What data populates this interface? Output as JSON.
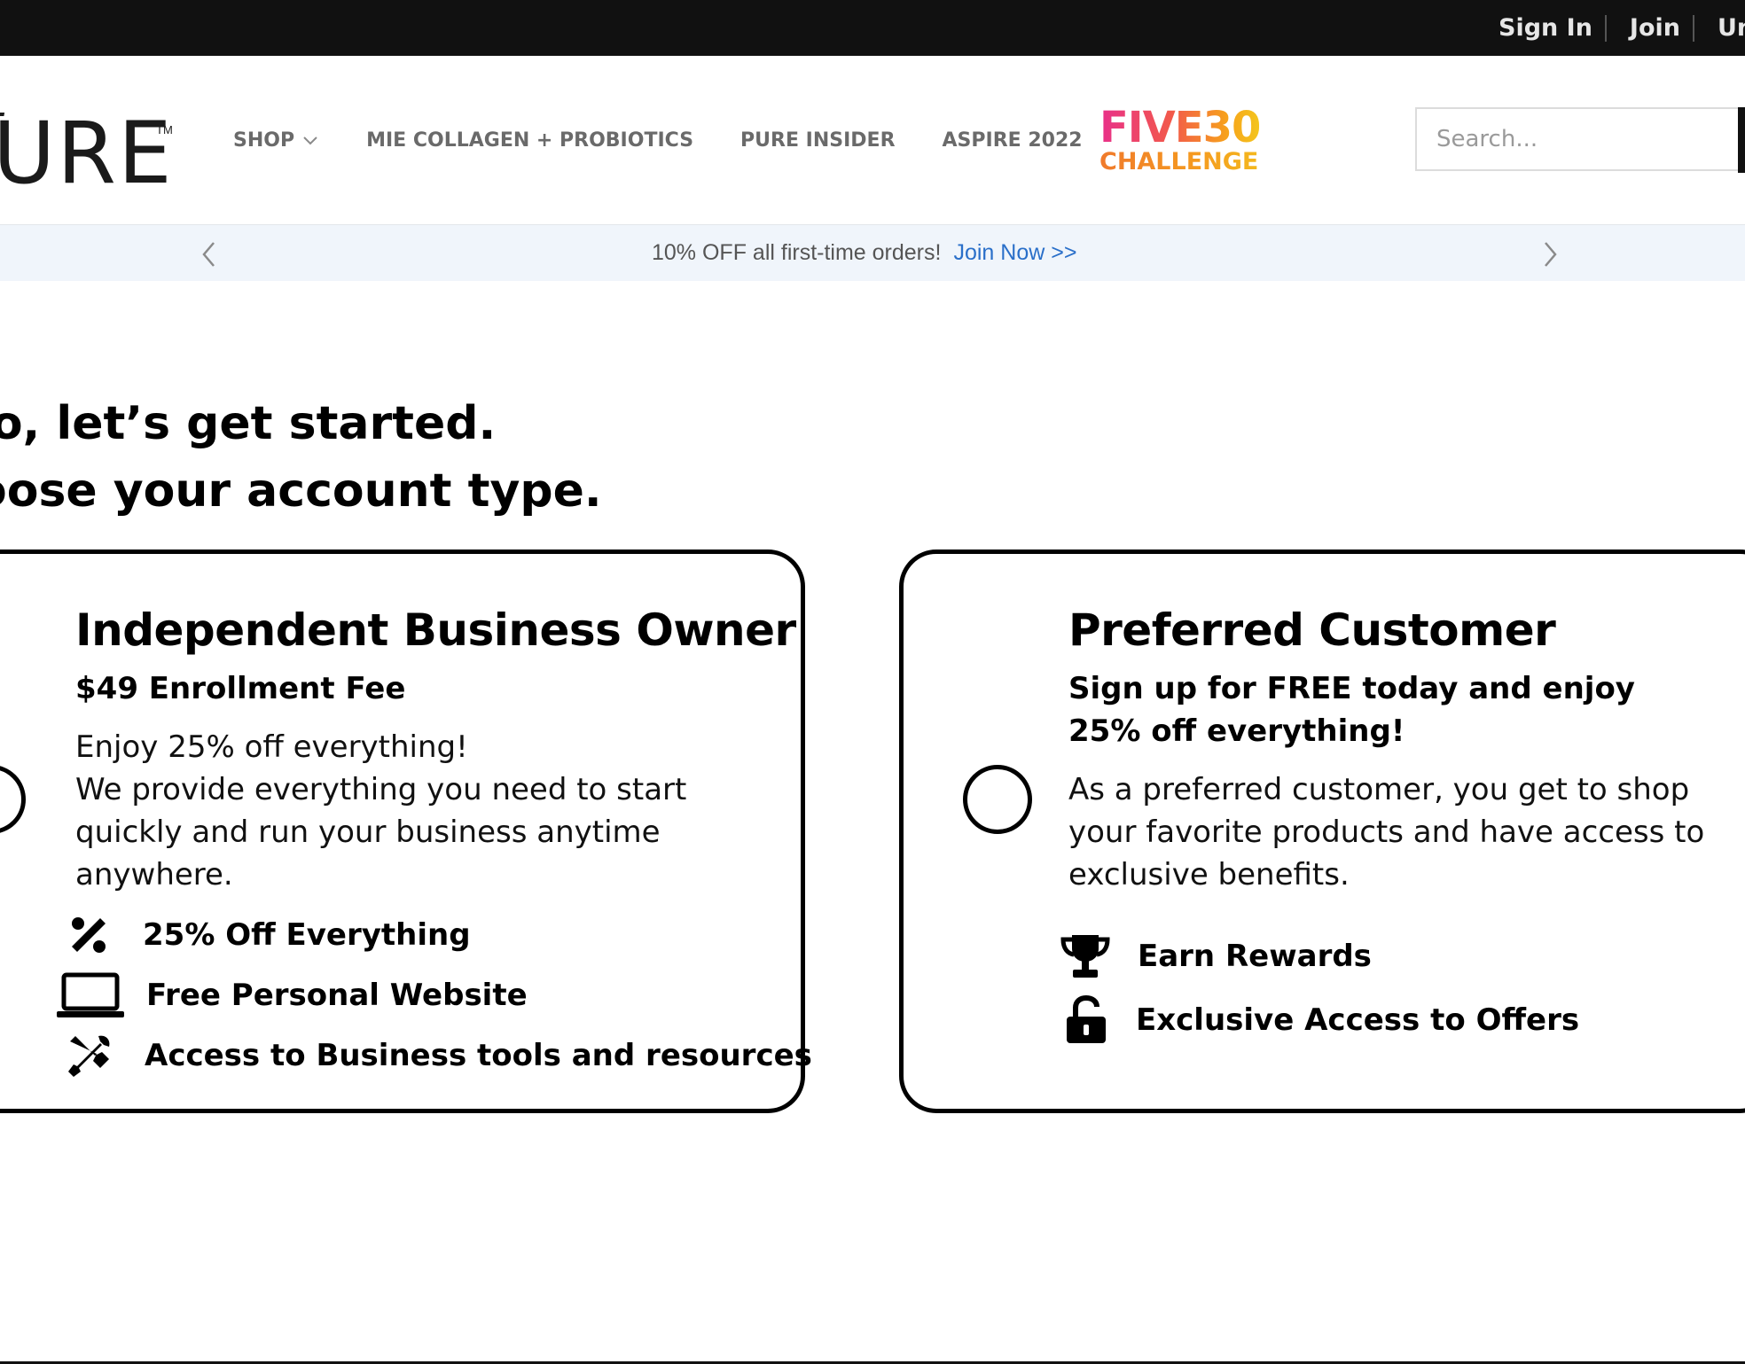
{
  "topbar": {
    "links": [
      "Sign In",
      "Join",
      "Uni"
    ]
  },
  "header": {
    "logo_text": "URE",
    "logo_tm": "TM",
    "nav": {
      "shop": "SHOP",
      "collagen": "MIE COLLAGEN + PROBIOTICS",
      "insider": "PURE INSIDER",
      "aspire": "ASPIRE 2022"
    },
    "five30": {
      "line1": "FIVE30",
      "line2": "CHALLENGE"
    },
    "search": {
      "placeholder": "Search..."
    }
  },
  "promo": {
    "text": "10% OFF all first-time orders!",
    "link": "Join Now >>"
  },
  "main": {
    "heading_line1": "lo, let’s get started.",
    "heading_line2": "oose your account type."
  },
  "cards": {
    "ibo": {
      "title": "Independent Business Owner",
      "subtitle": "$49 Enrollment Fee",
      "desc_line1": "Enjoy 25% off everything!",
      "desc_line2": "We provide everything you need to start quickly and run your business anytime anywhere.",
      "features": [
        {
          "icon": "percent-icon",
          "label": "25% Off Everything"
        },
        {
          "icon": "laptop-icon",
          "label": "Free Personal Website"
        },
        {
          "icon": "tools-icon",
          "label": "Access to Business tools and resources"
        }
      ]
    },
    "pc": {
      "title": "Preferred Customer",
      "subtitle": "Sign up for FREE today and enjoy 25% off everything!",
      "desc": "As a preferred customer, you get to shop your favorite products and have access to exclusive benefits.",
      "features": [
        {
          "icon": "trophy-icon",
          "label": "Earn Rewards"
        },
        {
          "icon": "unlock-icon",
          "label": "Exclusive Access to Offers"
        }
      ]
    }
  },
  "colors": {
    "topbar": "#111111",
    "promo_bg": "#f0f5fb",
    "link_blue": "#2a6fc9",
    "nav_gray": "#6a6a6a"
  }
}
